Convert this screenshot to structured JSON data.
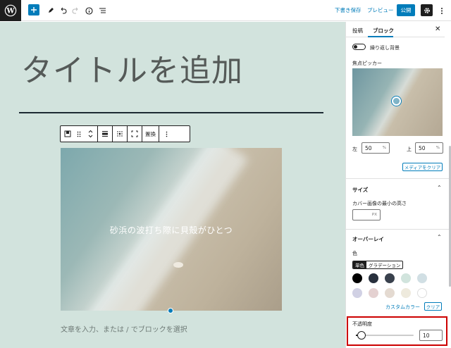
{
  "toolbar": {
    "draft_save_label": "下書き保存",
    "preview_label": "プレビュー",
    "publish_label": "公開"
  },
  "editor": {
    "title_placeholder": "タイトルを追加",
    "cover_text": "砂浜の波打ち際に貝殻がひとつ",
    "paragraph_placeholder": "文章を入力、または / でブロックを選択",
    "block_toolbar": {
      "replace_label": "置換"
    }
  },
  "sidebar": {
    "tabs": [
      {
        "label": "投稿"
      },
      {
        "label": "ブロック"
      }
    ],
    "repeat_background_label": "繰り返し背景",
    "focal_picker_label": "焦点ピッカー",
    "left_label": "左",
    "left_value": "50",
    "top_label": "上",
    "top_value": "50",
    "percent_unit": "%",
    "clear_media_label": "メディアをクリア",
    "size_section": {
      "title": "サイズ",
      "min_height_label": "カバー画像の最小の高さ",
      "min_height_unit": "PX"
    },
    "overlay_section": {
      "title": "オーバーレイ",
      "color_label": "色",
      "solid_label": "単色",
      "gradient_label": "グラデーション",
      "swatches": [
        "#000000",
        "#28303d",
        "#39414d",
        "#d1e4dd",
        "#d1dfe4",
        "#d1d1e4",
        "#e4d1d1",
        "#e4dad1",
        "#eeeadd",
        "#ffffff"
      ],
      "custom_color_label": "カスタムカラー",
      "clear_label": "クリア",
      "opacity_label": "不透明度",
      "opacity_value": "10",
      "opacity_level": 10
    }
  },
  "colors": {
    "accent": "#007cba",
    "canvas_bg": "#d2e3dd",
    "highlight": "#cc0000"
  }
}
